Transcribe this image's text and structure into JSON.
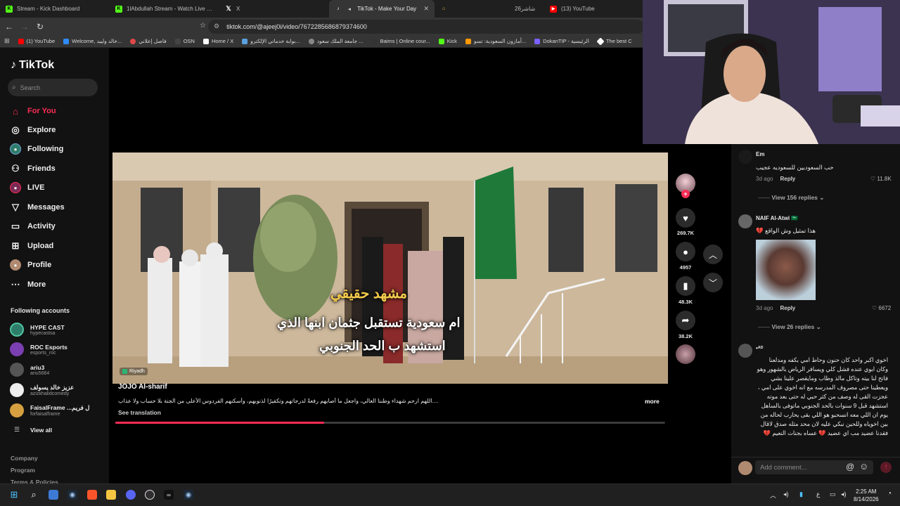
{
  "browser": {
    "tabs": [
      {
        "title": "Stream - Kick Dashboard",
        "icon": "kick-icon",
        "color": "#53fc18"
      },
      {
        "title": "1lAbdullah Stream - Watch Live on K",
        "icon": "kick-icon",
        "color": "#53fc18"
      },
      {
        "title": "X",
        "icon": "x-icon",
        "color": "#ffffff"
      },
      {
        "title": "TikTok - Make Your Day",
        "icon": "tiktok-icon",
        "color": "#ffffff",
        "active": true
      },
      {
        "title": "",
        "icon": "home-icon",
        "color": "#f5b942"
      },
      {
        "title": "شاشر26",
        "icon": "",
        "color": ""
      },
      {
        "title": "(13) YouTube",
        "icon": "youtube-icon",
        "color": "#ff0000"
      }
    ],
    "url": "tiktok.com/@ajeej0i/video/7672285686879374600",
    "bookmarks": [
      {
        "label": "(1) YouTube",
        "color": "#ff0000"
      },
      {
        "label": "Welcome, خالد ولييد...",
        "color": "#2d8cff"
      },
      {
        "label": "فاصل إعلاني",
        "color": "#e04848"
      },
      {
        "label": "OSN",
        "color": "#444444"
      },
      {
        "label": "Home / X",
        "color": "#ffffff"
      },
      {
        "label": "بوابة خدماتي الإلكترو...",
        "color": "#5aa0e0"
      },
      {
        "label": "جامعة الملك سعود ...",
        "color": "#888888"
      },
      {
        "label": "Baims | Online cour...",
        "color": "#333333"
      },
      {
        "label": "Kick",
        "color": "#53fc18"
      },
      {
        "label": "أمازون السعودية: تسو...",
        "color": "#ff9900"
      },
      {
        "label": "DokanTIP - الرئيسية",
        "color": "#7b61ff"
      },
      {
        "label": "The best C",
        "color": "#ffffff"
      }
    ]
  },
  "sidebar": {
    "logo": "TikTok",
    "search_placeholder": "Search",
    "menu": [
      {
        "label": "For You",
        "icon": "home-icon",
        "active": true
      },
      {
        "label": "Explore",
        "icon": "compass-icon"
      },
      {
        "label": "Following",
        "icon": "following-avatar-icon"
      },
      {
        "label": "Friends",
        "icon": "friends-icon"
      },
      {
        "label": "LIVE",
        "icon": "live-icon"
      },
      {
        "label": "Messages",
        "icon": "messages-icon"
      },
      {
        "label": "Activity",
        "icon": "activity-icon"
      },
      {
        "label": "Upload",
        "icon": "upload-icon"
      },
      {
        "label": "Profile",
        "icon": "profile-avatar-icon"
      },
      {
        "label": "More",
        "icon": "more-icon"
      }
    ],
    "following_title": "Following accounts",
    "accounts": [
      {
        "name": "HYPE CAST",
        "handle": "hypecastsa",
        "color": "#2e7d6b"
      },
      {
        "name": "ROC Esports",
        "handle": "esports_roc",
        "color": "#7a3fb0"
      },
      {
        "name": "ariu3",
        "handle": "ariu5664",
        "color": "#555555"
      },
      {
        "name": "عزيز خالد يسولف",
        "handle": "azizkhalidcomedy",
        "color": "#eeeeee"
      },
      {
        "name": "FaisalFrame ...ل فريم",
        "handle": "forfaisalframe",
        "color": "#d6a040"
      }
    ],
    "view_all": "View all",
    "footer": [
      "Company",
      "Program",
      "Terms & Policies"
    ]
  },
  "video": {
    "caption_top": "مشهد حقيقي",
    "caption_line1": "ام سعودية تستقبل جثمان ابنها الذي",
    "caption_line2": "استشهد ب الحد الجنوبي",
    "location": "Riyadh",
    "author": "JOJO Al-sharif",
    "description": "....اللهم ارحم شهداء وطننا الغالي، واجعل ما أصابهم رفعةً لدرجاتهم وتكفيرًا لذنوبهم، وأسكنهم الفردوس الأعلى من الجنة بلا حساب ولا عذاب",
    "see_translation": "See translation",
    "more": "more",
    "progress": 0.38
  },
  "actions": {
    "likes": "269.7K",
    "comments": "4957",
    "saves": "48.3K",
    "shares": "38.2K"
  },
  "comments": [
    {
      "name": "Em",
      "text": "حب السعوديين للسعوديه عجيب",
      "time": "3d ago",
      "reply": "Reply",
      "likes": "11.8K",
      "replies_label": "View 156 replies"
    },
    {
      "name": "NAIF Al-Atwi 🇸🇦",
      "text": "هذا تمثيل وش الواقع 💔",
      "time": "3d ago",
      "reply": "Reply",
      "likes": "6672",
      "replies_label": "View 26 replies"
    },
    {
      "name": "•ᴬᴰ",
      "text": "اخوي اكبر واحد كان حنون وحاط امي بكفه ومدلعنا وكان ابوي عنده فشل كلي ويسافر الرياض بالشهور وهو فاتح لنا بيته وتاكل مالذ وطاب ومايقصر علينا بشي ويعطينا حتى مصروف المدرسه مع انه اخوي على امي ، عجزت القى له وصف من كثر حبي له حتى بعد موته استشهد قبل 9 سنوات بالحد الجنوبي ماتوفى بالساهل يوم ان اللي معه انسحبو هو اللي بقى يحارب لحاله من بين اخوياه وللحين نبكي عليه لان محد مثله صدق لاقال فقدنا عضيد مب اي عضيد 💔 عساه بجنات النعيم 💔"
    }
  ],
  "add_comment_placeholder": "Add comment...",
  "taskbar": {
    "clock_time": "2:25 AM",
    "clock_date": "8/14/2026",
    "lang": "ع"
  }
}
